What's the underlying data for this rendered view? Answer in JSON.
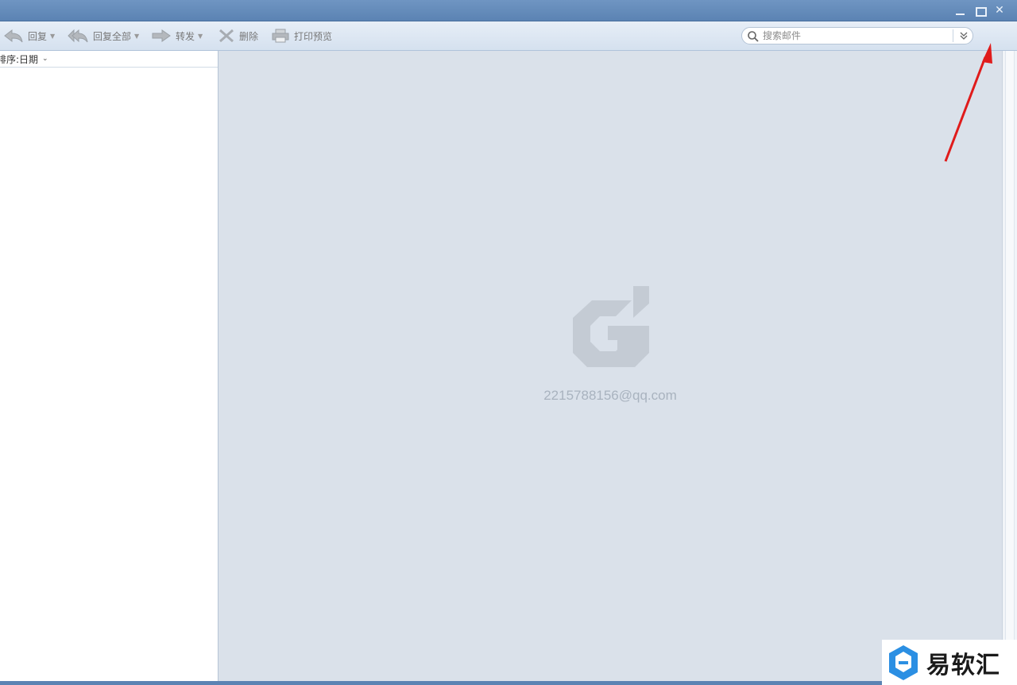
{
  "window": {
    "controls": {
      "minimize": "",
      "maximize": "",
      "close": "✕"
    }
  },
  "toolbar": {
    "reply_label": "回复",
    "reply_all_label": "回复全部",
    "forward_label": "转发",
    "delete_label": "删除",
    "print_preview_label": "打印预览",
    "search_placeholder": "搜索邮件"
  },
  "list": {
    "sort_label": "排序:日期",
    "sort_chevron": "⌄"
  },
  "preview": {
    "account_email": "2215788156@qq.com"
  },
  "watermark": {
    "text": "易软汇"
  },
  "colors": {
    "titlebar": "#5b83b3",
    "preview_bg": "#dae1ea",
    "annotation_arrow": "#e01b1b",
    "watermark_icon": "#2b8fe3"
  }
}
